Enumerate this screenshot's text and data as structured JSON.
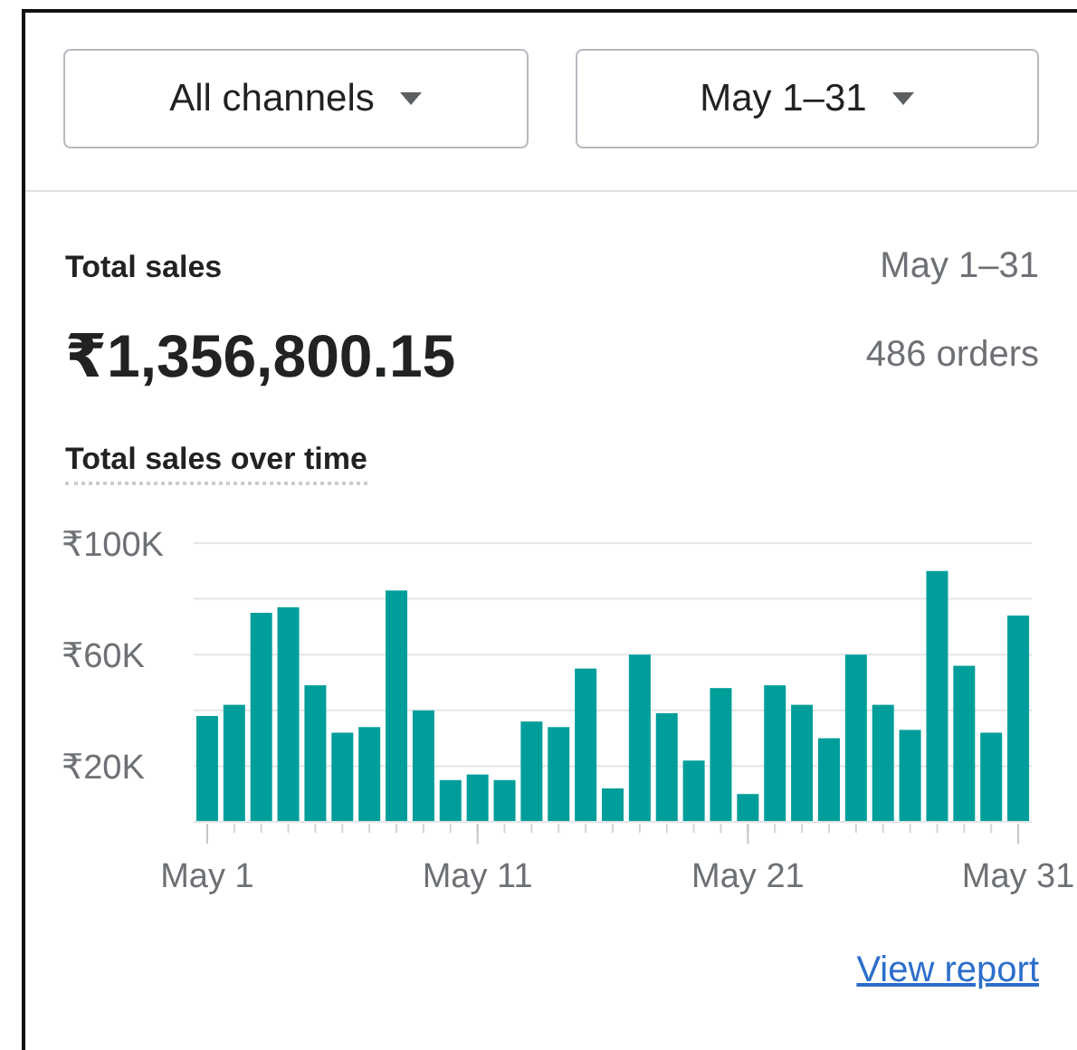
{
  "filters": [
    {
      "label": "All channels"
    },
    {
      "label": "May 1–31"
    }
  ],
  "summary": {
    "title": "Total sales",
    "period": "May 1–31",
    "amount": "₹1,356,800.15",
    "orders": "486 orders"
  },
  "chart": {
    "heading": "Total sales over time",
    "chart_data": {
      "type": "bar",
      "color": "#009e9a",
      "categories": [
        "May 1",
        null,
        null,
        null,
        null,
        null,
        null,
        null,
        null,
        null,
        "May 11",
        null,
        null,
        null,
        null,
        null,
        null,
        null,
        null,
        null,
        "May 21",
        null,
        null,
        null,
        null,
        null,
        null,
        null,
        null,
        null,
        "May 31"
      ],
      "values": [
        38000,
        42000,
        75000,
        77000,
        49000,
        32000,
        34000,
        83000,
        40000,
        15000,
        17000,
        15000,
        36000,
        34000,
        55000,
        12000,
        60000,
        39000,
        22000,
        48000,
        10000,
        49000,
        42000,
        30000,
        60000,
        42000,
        33000,
        90000,
        56000,
        32000,
        74000
      ],
      "ylim": [
        0,
        100000
      ],
      "yticks": [
        {
          "value": 20000,
          "label": "₹20K"
        },
        {
          "value": 60000,
          "label": "₹60K"
        },
        {
          "value": 100000,
          "label": "₹100K"
        }
      ]
    }
  },
  "link": "View report"
}
